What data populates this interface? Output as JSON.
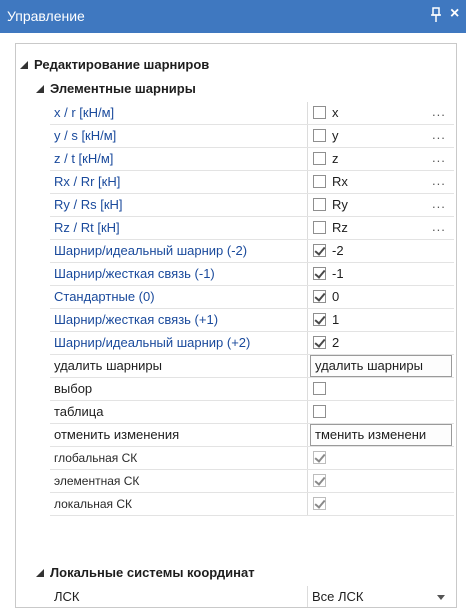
{
  "window": {
    "title": "Управление"
  },
  "sections": {
    "hinge_edit": "Редактирование шарниров",
    "element_hinges": "Элементные шарниры",
    "local_cs": "Локальные системы координат"
  },
  "rows": [
    {
      "name": "x / r [кН/м]",
      "checked": false,
      "value": "x",
      "dots": "..."
    },
    {
      "name": "y / s [кН/м]",
      "checked": false,
      "value": "y",
      "dots": "..."
    },
    {
      "name": "z / t [кН/м]",
      "checked": false,
      "value": "z",
      "dots": "..."
    },
    {
      "name": "Rx / Rr [кН]",
      "checked": false,
      "value": "Rx",
      "dots": "..."
    },
    {
      "name": "Ry / Rs [кН]",
      "checked": false,
      "value": "Ry",
      "dots": "..."
    },
    {
      "name": "Rz / Rt [кН]",
      "checked": false,
      "value": "Rz",
      "dots": "..."
    },
    {
      "name": "Шарнир/идеальный шарнир (-2)",
      "checked": true,
      "value": "-2"
    },
    {
      "name": "Шарнир/жесткая связь (-1)",
      "checked": true,
      "value": "-1"
    },
    {
      "name": "Стандартные (0)",
      "checked": true,
      "value": "0"
    },
    {
      "name": "Шарнир/жесткая связь (+1)",
      "checked": true,
      "value": "1"
    },
    {
      "name": "Шарнир/идеальный шарнир (+2)",
      "checked": true,
      "value": "2"
    }
  ],
  "actions": {
    "delete_label": "удалить шарниры",
    "delete_button": "удалить шарниры",
    "selection_label": "выбор",
    "table_label": "таблица",
    "undo_label": "отменить изменения",
    "undo_button": "тменить изменени"
  },
  "cs_rows": [
    {
      "name": "глобальная СК",
      "checked": true
    },
    {
      "name": "элементная СК",
      "checked": true
    },
    {
      "name": "локальная СК",
      "checked": true
    }
  ],
  "lsk": {
    "label": "ЛСК",
    "value": "Все ЛСК"
  }
}
